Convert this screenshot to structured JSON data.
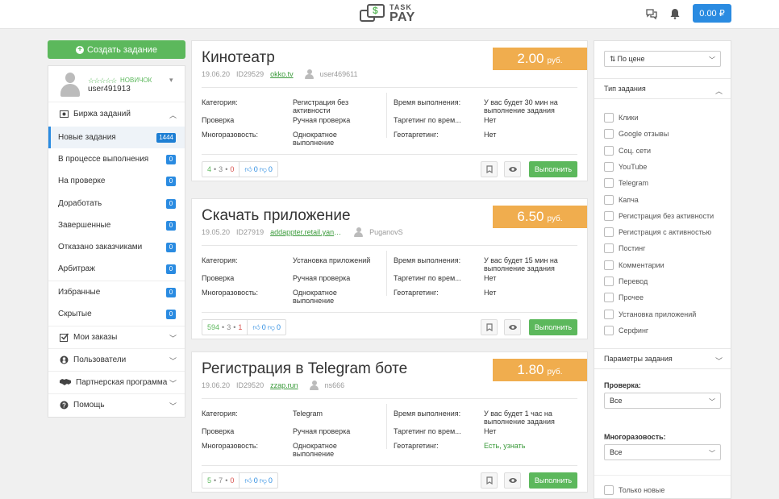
{
  "header": {
    "logo_top": "TASK",
    "logo_bottom": "PAY",
    "balance": "0.00 ₽"
  },
  "sidebar": {
    "create_label": "Создать задание",
    "user": {
      "stars": "☆☆☆☆☆",
      "rank": "НОВИЧОК",
      "name": "user491913"
    },
    "exchange_label": "Биржа заданий",
    "items": [
      {
        "label": "Новые задания",
        "count": "1444"
      },
      {
        "label": "В процессе выполнения",
        "count": "0"
      },
      {
        "label": "На проверке",
        "count": "0"
      },
      {
        "label": "Доработать",
        "count": "0"
      },
      {
        "label": "Завершенные",
        "count": "0"
      },
      {
        "label": "Отказано заказчиками",
        "count": "0"
      },
      {
        "label": "Арбитраж",
        "count": "0"
      },
      {
        "label": "Избранные",
        "count": "0"
      },
      {
        "label": "Скрытые",
        "count": "0"
      }
    ],
    "sections": {
      "my_orders": "Мои заказы",
      "users": "Пользователи",
      "partner": "Партнерская программа",
      "help": "Помощь"
    }
  },
  "labels": {
    "category": "Категория:",
    "check": "Проверка",
    "multiplicity": "Многоразовость:",
    "exec_time": "Время выполнения:",
    "targeting": "Таргетинг по врем...",
    "geotargeting": "Геотаргетинг:",
    "execute": "Выполнить",
    "currency": "руб."
  },
  "tasks": [
    {
      "title": "Кинотеатр",
      "price": "2.00",
      "date": "19.06.20",
      "id": "ID29529",
      "link": "okko.tv",
      "author": "user469611",
      "category": "Регистрация без активности",
      "check": "Ручная проверка",
      "multiplicity": "Однократное выполнение",
      "exec_time": "У вас будет 30 мин на выполнение задания",
      "targeting": "Нет",
      "geo": "Нет",
      "stat_a": "4",
      "stat_b": "3",
      "stat_c": "0",
      "likes": "0",
      "dislikes": "0"
    },
    {
      "title": "Скачать приложение",
      "price": "6.50",
      "date": "19.05.20",
      "id": "ID27919",
      "link": "addappter.retail.yand...",
      "author": "PuganovS",
      "category": "Установка приложений",
      "check": "Ручная проверка",
      "multiplicity": "Однократное выполнение",
      "exec_time": "У вас будет 15 мин на выполнение задания",
      "targeting": "Нет",
      "geo": "Нет",
      "stat_a": "594",
      "stat_b": "3",
      "stat_c": "1",
      "likes": "0",
      "dislikes": "0"
    },
    {
      "title": "Регистрация в Telegram боте",
      "price": "1.80",
      "date": "19.06.20",
      "id": "ID29520",
      "link": "zzap.run",
      "author": "ns666",
      "category": "Telegram",
      "check": "Ручная проверка",
      "multiplicity": "Однократное выполнение",
      "exec_time": "У вас будет 1 час на выполнение задания",
      "targeting": "Нет",
      "geo": "Есть, узнать",
      "stat_a": "5",
      "stat_b": "7",
      "stat_c": "0",
      "likes": "0",
      "dislikes": "0"
    }
  ],
  "filters": {
    "sort": "По цене",
    "type_head": "Тип задания",
    "types": [
      "Клики",
      "Google отзывы",
      "Соц. сети",
      "YouTube",
      "Telegram",
      "Капча",
      "Регистрация без активности",
      "Регистрация с активностью",
      "Постинг",
      "Комментарии",
      "Перевод",
      "Прочее",
      "Установка приложений",
      "Серфинг"
    ],
    "params_head": "Параметры задания",
    "check_label": "Проверка:",
    "check_value": "Все",
    "multi_label": "Многоразовость:",
    "multi_value": "Все",
    "only_new": "Только новые"
  }
}
